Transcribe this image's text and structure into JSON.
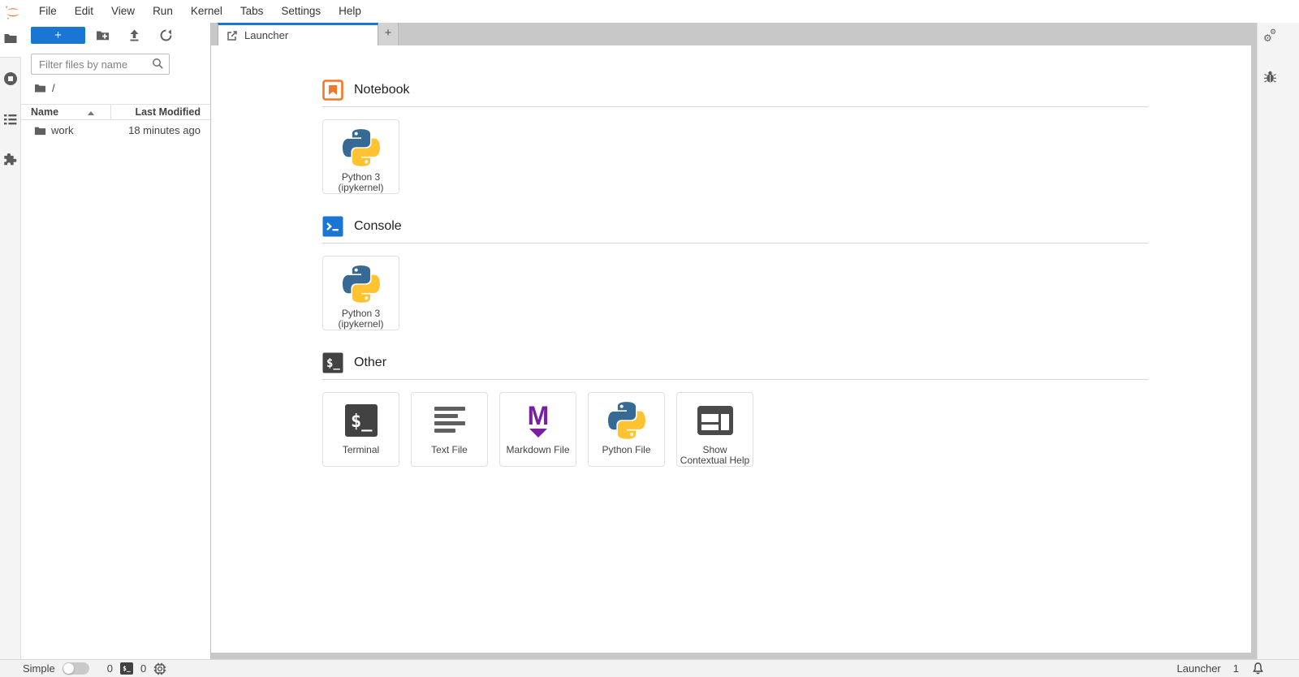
{
  "menu": {
    "items": [
      "File",
      "Edit",
      "View",
      "Run",
      "Kernel",
      "Tabs",
      "Settings",
      "Help"
    ]
  },
  "left_activity_bar": {
    "icons": [
      "folder-icon",
      "running-kernels-icon",
      "table-of-contents-icon",
      "extensions-puzzle-icon"
    ]
  },
  "file_browser": {
    "toolbar": {
      "new_launcher": "+",
      "icons": [
        "new-folder-icon",
        "upload-icon",
        "refresh-icon"
      ]
    },
    "filter": {
      "placeholder": "Filter files by name",
      "value": "",
      "icon": "search-icon"
    },
    "breadcrumb": {
      "icon": "folder-icon",
      "path": "/"
    },
    "listing": {
      "columns": [
        {
          "label": "Name",
          "sort_icon": "caret-up-icon"
        },
        {
          "label": "Last Modified"
        }
      ],
      "rows": [
        {
          "icon": "folder-icon",
          "name": "work",
          "last_modified": "18 minutes ago"
        }
      ]
    }
  },
  "dock": {
    "tabs": [
      {
        "icon": "launcher-icon",
        "label": "Launcher",
        "active": true
      }
    ],
    "add_tab": "+"
  },
  "launcher": {
    "sections": [
      {
        "title": "Notebook",
        "icon": "notebook-icon",
        "cards": [
          {
            "icon": "python-logo-icon",
            "label": "Python 3 (ipykernel)"
          }
        ]
      },
      {
        "title": "Console",
        "icon": "console-icon",
        "cards": [
          {
            "icon": "python-logo-icon",
            "label": "Python 3 (ipykernel)"
          }
        ]
      },
      {
        "title": "Other",
        "icon": "terminal-icon",
        "cards": [
          {
            "icon": "terminal-icon",
            "label": "Terminal"
          },
          {
            "icon": "text-file-icon",
            "label": "Text File"
          },
          {
            "icon": "markdown-file-icon",
            "label": "Markdown File"
          },
          {
            "icon": "python-logo-icon",
            "label": "Python File"
          },
          {
            "icon": "contextual-help-icon",
            "label": "Show Contextual Help"
          }
        ]
      }
    ]
  },
  "right_activity_bar": {
    "icons": [
      "property-inspector-gears-icon",
      "debugger-bug-icon"
    ]
  },
  "status_bar": {
    "left": {
      "mode_label": "Simple",
      "toggle_state": "off",
      "terminal_count": "0",
      "kernel_count": "0",
      "icons": [
        "terminal-icon",
        "kernel-chip-icon"
      ]
    },
    "right": {
      "context_label": "Launcher",
      "notifications_count": "1",
      "icon": "bell-icon"
    }
  },
  "colors": {
    "accent_blue": "#1976d2",
    "jupyter_orange": "#f37726",
    "markdown_purple": "#7b1fa2",
    "icon_gray": "#5a5a5a",
    "tab_bar_bg": "#c8c8c8",
    "panel_bg": "#f4f4f4",
    "terminal_dark": "#424242"
  }
}
